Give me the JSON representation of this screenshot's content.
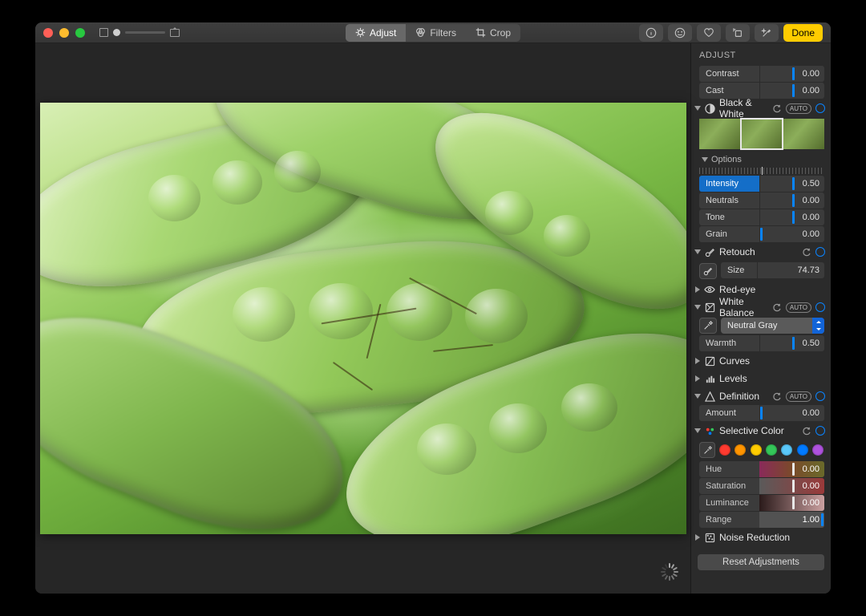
{
  "toolbar": {
    "adjust": "Adjust",
    "filters": "Filters",
    "crop": "Crop",
    "done": "Done"
  },
  "sidebar": {
    "title": "ADJUST",
    "contrast": {
      "label": "Contrast",
      "value": "0.00"
    },
    "cast": {
      "label": "Cast",
      "value": "0.00"
    },
    "bw": {
      "title": "Black & White",
      "auto": "AUTO",
      "options": "Options",
      "intensity": {
        "label": "Intensity",
        "value": "0.50"
      },
      "neutrals": {
        "label": "Neutrals",
        "value": "0.00"
      },
      "tone": {
        "label": "Tone",
        "value": "0.00"
      },
      "grain": {
        "label": "Grain",
        "value": "0.00"
      }
    },
    "retouch": {
      "title": "Retouch",
      "size": {
        "label": "Size",
        "value": "74.73"
      }
    },
    "redeye": {
      "title": "Red-eye"
    },
    "wb": {
      "title": "White Balance",
      "auto": "AUTO",
      "mode": "Neutral Gray",
      "warmth": {
        "label": "Warmth",
        "value": "0.50"
      }
    },
    "curves": {
      "title": "Curves"
    },
    "levels": {
      "title": "Levels"
    },
    "definition": {
      "title": "Definition",
      "auto": "AUTO",
      "amount": {
        "label": "Amount",
        "value": "0.00"
      }
    },
    "selcolor": {
      "title": "Selective Color",
      "swatches": [
        "#ff3b30",
        "#ff9500",
        "#ffcc00",
        "#34c759",
        "#5ac8fa",
        "#007aff",
        "#af52de"
      ],
      "hue": {
        "label": "Hue",
        "value": "0.00"
      },
      "saturation": {
        "label": "Saturation",
        "value": "0.00"
      },
      "luminance": {
        "label": "Luminance",
        "value": "0.00"
      },
      "range": {
        "label": "Range",
        "value": "1.00"
      }
    },
    "noise": {
      "title": "Noise Reduction"
    },
    "reset": "Reset Adjustments"
  }
}
